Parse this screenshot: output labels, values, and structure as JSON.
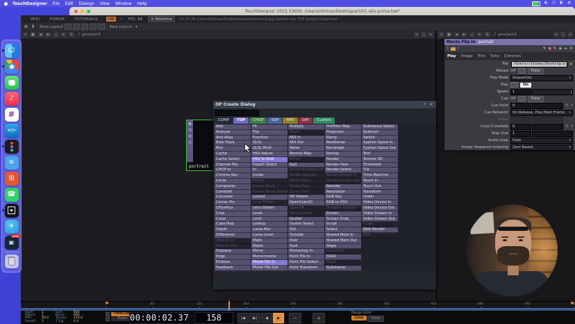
{
  "menu_bar": {
    "app_name": "TouchDesigner",
    "items": [
      "File",
      "Edit",
      "Dialogs",
      "View",
      "Window",
      "Help"
    ]
  },
  "window": {
    "title": "TouchDesigner 2022.33600: /Users/rikimas/Desktop/art/01-alla-prima.toe*"
  },
  "top_toolbar": {
    "links": [
      "WIKI",
      "FORUM",
      "TUTORIALS"
    ],
    "badge": "CHI",
    "fps_label": "FPS:",
    "fps_value": "51",
    "realtime_label": "Realtime",
    "realtime_check": "✕",
    "status_message": "13:37:26 /Users/rikimas/Desktop/assets/portrait.jpg loaded into TOP /project1/portrait"
  },
  "layout_toolbar": {
    "pane_layout_label": "Pane Layout",
    "new_layout_label": "New Layout",
    "add_label": "+"
  },
  "panes": {
    "left_path": "/ project1",
    "right_path": "/ project1",
    "bar_icons": [
      "▾",
      "■",
      "◀",
      "▶",
      "＋",
      "★",
      "⊞"
    ],
    "ctrl_icons": [
      "≡",
      "□",
      "≡"
    ]
  },
  "network": {
    "selected_node_label": "portrait"
  },
  "op_create_dialog": {
    "title": "OP Create Dialog",
    "help_label": "?",
    "close_label": "✕",
    "search_placeholder": "",
    "tabs": [
      {
        "label": "COMP",
        "color": "#262a33",
        "active": false
      },
      {
        "label": "TOP",
        "color": "#6f68c4",
        "active": true
      },
      {
        "label": "CHOP",
        "color": "#3f7d49",
        "active": false
      },
      {
        "label": "SOP",
        "color": "#46659f",
        "active": false
      },
      {
        "label": "MAT",
        "color": "#8f7d26",
        "active": false
      },
      {
        "label": "DAT",
        "color": "#8a3047",
        "active": false
      },
      {
        "label": "Custom",
        "color": "#2f8a63",
        "active": false
      }
    ],
    "columns": [
      [
        "Add",
        "Analyze",
        "Anti Alias",
        "Blob Track",
        "Blur",
        "Cache",
        "Cache Select",
        "Channel Mix",
        "CHOP to",
        "Chroma Key",
        "Circle",
        "Composite",
        "Constant",
        "Convolve",
        "Corner Pin",
        "CPlusPlus",
        "Crop",
        "Cross",
        "Cube Map",
        "Depth",
        "Difference",
        "DirectX In",
        "DirectX Out",
        "Displace",
        "Edge",
        "Emboss",
        "Feedback"
      ],
      [
        "Fit",
        "Flip",
        "Function",
        "GLSL",
        "GLSL Multi",
        "HSV Adjust",
        "HSV to RGB",
        "Import Select",
        "In",
        "Inside",
        "Kinect",
        "Kinect Azure",
        "Kinect Azure Select",
        "Layout",
        "Leap Motion",
        "Lens Distort",
        "Level",
        "Limit",
        "Lookup",
        "Luma Blur",
        "Luma Level",
        "Math",
        "Matte",
        "Mirror",
        "Monochrome",
        "Movie File In",
        "Movie File Out"
      ],
      [
        "Multiply",
        "Ncam",
        "NDI In",
        "NDI Out",
        "Noise",
        "Normal Map",
        "Notch",
        "Null",
        "Nvidia Background",
        "Nvidia Denoise",
        "Nvidia Flex",
        "Nvidia Flow",
        "Oculus Rift",
        "OP Viewer",
        "OpenColorIO",
        "OpenVR",
        "Optical Flow",
        "Ouster",
        "Ouster Select",
        "Out",
        "Outside",
        "Over",
        "Pack",
        "Photoshop In",
        "Point File In",
        "Point File Select",
        "Point Transform"
      ],
      [
        "PreFilter Map",
        "Projection",
        "Ramp",
        "RealSense",
        "Rectangle",
        "Remap",
        "Render",
        "Render Pass",
        "Render Select",
        "RenderStream In",
        "RenderStream Out",
        "Reorder",
        "Resolution",
        "RGB Key",
        "RGB to HSV",
        "Scalable Display",
        "Screen",
        "Screen Grab",
        "Script",
        "Select",
        "Shared Mem In",
        "Shared Mem Out",
        "Slope",
        "Spectrum",
        "SSAO",
        "Stype",
        "Substance"
      ],
      [
        "Substance Select",
        "Subtract",
        "Switch",
        "Syphon Spout In",
        "Syphon Spout Out",
        "Text",
        "Texture 3D",
        "Threshold",
        "Tile",
        "Time Machine",
        "Touch In",
        "Touch Out",
        "Transform",
        "Under",
        "Video Device In",
        "Video Device Out",
        "Video Stream In",
        "Video Stream Out",
        "Vioso",
        "Web Render",
        "ZED"
      ]
    ],
    "disabled": [
      "DirectX In",
      "DirectX Out",
      "Kinect",
      "Kinect Azure",
      "Kinect Azure Select",
      "Leap Motion",
      "Ncam",
      "Notch",
      "Nvidia Background",
      "Nvidia Denoise",
      "Nvidia Flex",
      "Nvidia Flow",
      "Oculus Rift",
      "OpenVR",
      "Optical Flow",
      "RenderStream In",
      "RenderStream Out",
      "Scalable Display",
      "Spectrum",
      "Stype",
      "Vioso",
      "ZED"
    ],
    "highlighted": [
      "HSV to RGB",
      "Movie File In"
    ]
  },
  "param_panel": {
    "op_type": "Movie File In",
    "node_name": "portrait",
    "header_icons_left": [
      {
        "name": "help-icon",
        "glyph": "?"
      },
      {
        "name": "folder-icon",
        "glyph": ""
      },
      {
        "name": "info-icon",
        "glyph": "i"
      }
    ],
    "header_icons_right": [
      {
        "name": "edit-icon",
        "glyph": "✎",
        "color": "#cfcfd4"
      },
      {
        "name": "comment-icon",
        "glyph": "●",
        "color": "#d66a9a"
      },
      {
        "name": "reload-icon",
        "glyph": "↻",
        "color": "#cfcfd4"
      },
      {
        "name": "network-icon",
        "glyph": "◉",
        "color": "#7ac46a"
      },
      {
        "name": "add-icon",
        "glyph": "+",
        "color": "#ffffff"
      },
      {
        "name": "settings-icon",
        "glyph": "⚙",
        "color": "#b0b0b6"
      }
    ],
    "tabs": [
      "Play",
      "Image",
      "Trim",
      "Tune",
      "Common"
    ],
    "active_tab": "Play",
    "rows": [
      {
        "label": "File",
        "kind": "file",
        "value": "/Users/rikimas/Desktop/a",
        "button": "+"
      },
      {
        "label": "Reload",
        "kind": "toggle_pulse",
        "state": "Off",
        "pulse_label": "Pulse"
      },
      {
        "label": "Play Mode",
        "kind": "dropdown",
        "value": "Sequential"
      },
      {
        "label": "Play",
        "kind": "toggle_on",
        "value": "On"
      },
      {
        "label": "Speed",
        "kind": "slider",
        "value": "1"
      },
      {
        "label": "Cue",
        "kind": "toggle_pulse",
        "state": "Off",
        "pulse_label": "Pulse"
      },
      {
        "label": "Cue Point",
        "kind": "number_unit",
        "value": "0",
        "unit": "%"
      },
      {
        "label": "Cue Behavior",
        "kind": "dropdown",
        "value": "On Release, Play Next Frame"
      },
      {
        "label": "Index",
        "kind": "number_unit",
        "value": "",
        "unit": "",
        "disabled": true
      },
      {
        "label": "Loop Crossfade",
        "kind": "number_unit",
        "value": "0",
        "unit": "%"
      },
      {
        "label": "Step Size",
        "kind": "number",
        "value": "1"
      },
      {
        "label": "Audio Loop",
        "kind": "dropdown",
        "value": "Fade"
      },
      {
        "label": "Image Sequence Indexing",
        "kind": "dropdown",
        "value": "Zero Based"
      }
    ]
  },
  "timeline": {
    "info_rows": [
      {
        "l1": "Start:",
        "v1": "1",
        "l2": "End:",
        "v2": "600"
      },
      {
        "l1": "RStart:",
        "v1": "1",
        "l2": "REnd:",
        "v2": "600"
      },
      {
        "l1": "FPS:",
        "v1": "60.0",
        "l2": "Tempo:",
        "v2": "120.0"
      },
      {
        "l1": "ResetF:",
        "v1": "1",
        "l2": "T Sig:",
        "v2": "4  4"
      }
    ],
    "timecode_label": "TimeCode",
    "beats_label": "Beats",
    "time_display": "00:00:02.37",
    "frame_display": "158",
    "transport": [
      "|◀",
      "▶|",
      "◀",
      "▶"
    ],
    "zoom_out_label": "−",
    "zoom_in_label": "+",
    "range_limit_label": "Range Limit",
    "loop_label": "Loop",
    "once_label": "Once",
    "ruler_start": 1,
    "ruler_end": 600,
    "ticks": [
      1,
      61,
      121,
      181,
      241,
      301,
      361,
      421,
      481,
      541,
      600
    ],
    "playhead_frame": 158
  },
  "dock": {
    "items": [
      {
        "name": "finder",
        "color": "#1f9ff2",
        "glyph": "☺",
        "running": true
      },
      {
        "name": "chrome",
        "color": "#ffffff",
        "glyph": "",
        "running": true
      },
      {
        "name": "messages",
        "color": "#3ecf5e",
        "glyph": "",
        "running": false
      },
      {
        "name": "music",
        "color": "#fb4357",
        "glyph": "♪",
        "running": false
      },
      {
        "name": "slack",
        "color": "#ffffff",
        "glyph": "#",
        "running": false
      },
      {
        "name": "vscode",
        "color": "#1b9be2",
        "glyph": "</>",
        "running": false
      },
      {
        "name": "figma",
        "color": "#1c1c1e",
        "glyph": "",
        "running": true
      },
      {
        "name": "preview",
        "color": "#4ba3e8",
        "glyph": "≡",
        "running": false
      },
      {
        "name": "calendar",
        "color": "#e8552e",
        "glyph": "⊞",
        "running": false
      },
      {
        "name": "whatsapp",
        "color": "#2fd366",
        "glyph": "☎",
        "running": false
      },
      {
        "name": "touchdesigner",
        "color": "#141416",
        "glyph": "",
        "running": true
      },
      {
        "name": "telegram",
        "color": "#37aee2",
        "glyph": "✈",
        "running": false
      },
      {
        "name": "live",
        "color": "#152638",
        "glyph": "▣",
        "running": false,
        "badge": "LIVE"
      },
      {
        "name": "trash",
        "color": "#e1e5ff",
        "glyph": "",
        "running": false
      }
    ]
  },
  "colors": {
    "accent_orange": "#cf7d2e",
    "selection_green": "#3fbf3f",
    "top_family_purple": "#6f68c4",
    "play_highlight": "#e09040",
    "desktop_blue": "#3e41d8"
  }
}
